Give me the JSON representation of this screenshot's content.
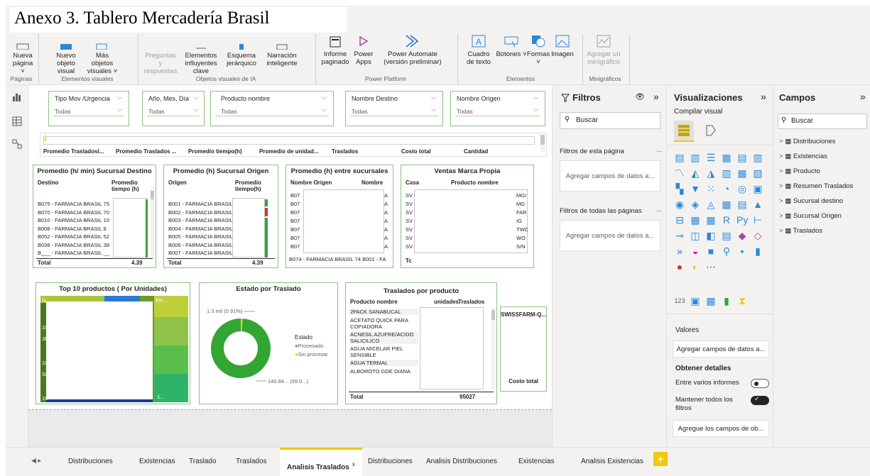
{
  "doc_title": "Anexo 3. Tablero Mercadería Brasil",
  "ribbon": {
    "buttons": [
      {
        "id": "nueva-pagina",
        "label": "Nueva página ˅"
      },
      {
        "id": "nuevo-objeto",
        "label": "Nuevo objeto visual"
      },
      {
        "id": "mas-objetos",
        "label": "Más objetos visuales ˅"
      },
      {
        "id": "preguntas",
        "label": "Preguntas y respuestas"
      },
      {
        "id": "elementos-influyentes",
        "label": "Elementos influyentes clave"
      },
      {
        "id": "esquema",
        "label": "Esquema jerárquico"
      },
      {
        "id": "narracion",
        "label": "Narración inteligente"
      },
      {
        "id": "informe-paginado",
        "label": "Informe paginado"
      },
      {
        "id": "power-apps",
        "label": "Power Apps"
      },
      {
        "id": "power-automate",
        "label": "Power Automate (versión preliminar)"
      },
      {
        "id": "cuadro-texto",
        "label": "Cuadro de texto"
      },
      {
        "id": "botones",
        "label": "Botones ˅"
      },
      {
        "id": "formas",
        "label": "Formas ˅"
      },
      {
        "id": "imagen",
        "label": "Imagen"
      },
      {
        "id": "minigrafico",
        "label": "Agregar un minigráfico"
      }
    ],
    "groups": [
      "Páginas",
      "Elementos visuales",
      "Objetos visuales de IA",
      "Power Platform",
      "Elementos",
      "Minigráficos"
    ]
  },
  "slicers": [
    {
      "label": "Tipo Mov /Urgencia",
      "value": "Todas"
    },
    {
      "label": "Año, Mes, Día",
      "value": "Todas"
    },
    {
      "label": "Producto nombre",
      "value": "Todas"
    },
    {
      "label": "Nombre Destino",
      "value": "Todas"
    },
    {
      "label": "Nombre Origen",
      "value": "Todas"
    }
  ],
  "card_row": {
    "value": "1",
    "headers": [
      "Promedio Trasladosl...",
      "Promedio Traslados ...",
      "Promedio tiempo(h)",
      "Promedio de unidad...",
      "Traslados",
      "Costo total",
      "Cantidad"
    ]
  },
  "table_destino": {
    "title": "Promedio (h/ min) Sucursal Destino",
    "col1": "Destino",
    "col2": "Promedio tiempo (h)",
    "rows": [
      "B075 - FARMACIA BRASIL 75",
      "B070 - FARMACIA BRASIL 70",
      "B010 - FARMACIA BRASIL 10",
      "B008 - FARMACIA BRASIL 8",
      "B052 - FARMACIA BRASIL 52",
      "B038 - FARMACIA BRASIL 38",
      "B___ - FARMACIA BRASIL __"
    ],
    "total_label": "Total",
    "total_value": "4.39"
  },
  "table_origen": {
    "title": "Promedio (h) Sucursal Origen",
    "col1": "Origen",
    "col2": "Promedio tiempo(h)",
    "rows": [
      "B001 - FARMACIA BRASIL",
      "B002 - FARMACIA BRASIL",
      "B003 - FARMACIA BRASIL",
      "B004 - FARMACIA BRASIL",
      "B005 - FARMACIA BRASIL",
      "B006 - FARMACIA BRASIL",
      "B007 - FARMACIA BRASIL"
    ],
    "total_label": "Total",
    "total_value": "4.39"
  },
  "table_entre": {
    "title": "Promedio (h) entre sucursales",
    "col1": "Nombre Origen",
    "col2": "Nombre",
    "rows": [
      "B07",
      "B07",
      "B07",
      "B07",
      "B07",
      "B07",
      "B07"
    ],
    "row_suffix": "A",
    "last_row": "B074 - FARMACIA BRASIL 74  B001 - FA"
  },
  "table_ventas": {
    "title": "Ventas Marca Propia",
    "col1": "Casa",
    "col2": "Producto nombre",
    "rows_left": [
      "SV",
      "SV",
      "SV",
      "SV",
      "SV",
      "SV",
      "SV"
    ],
    "rows_right": [
      "MG/",
      "MG",
      "FAR",
      "IG",
      "TWC",
      "WO",
      "S/N"
    ],
    "total_label": "Tc"
  },
  "top10": {
    "title": "Top 10 productos ( Por Unidades)",
    "labels": [
      "N",
      "10",
      "JE",
      "10",
      "SL",
      "10",
      "ER...",
      "1..."
    ]
  },
  "donut": {
    "title": "Estado por Traslado",
    "label_small": "1.3 mil (0.91%)",
    "label_large": "140.84... (99.0...)",
    "legend_title": "Estado",
    "legend": [
      {
        "name": "Procesado",
        "color": "#33a532"
      },
      {
        "name": "Sin procesar",
        "color": "#d6d613"
      }
    ],
    "values": [
      99.09,
      0.91
    ]
  },
  "traslados_prod": {
    "title": "Traslados por producto",
    "col1": "Producto nombre",
    "col2": "unidades",
    "col3": "Traslados",
    "rows": [
      "2PACK SANABUCAL",
      "ACETATO QUICK PARA COPIADORA",
      "ACNESIL AZUFRE/ACIDO SALICILICO",
      "AGUA MICELAR PIEL SENSIBLE",
      "AGUA TERMAL",
      "ALBOROTO GDE DIANA"
    ],
    "total_label": "Total",
    "total_value": "95027"
  },
  "swissfarm": {
    "title": "SWISSFARM-Q...",
    "footer": "Costo total"
  },
  "filters": {
    "title": "Filtros",
    "search": "Buscar",
    "this_page": "Filtros de esta página",
    "drop1": "Agregar campos de datos a...",
    "all_pages": "Filtros de todas las páginas",
    "drop2": "Agregar campos de datos a...",
    "more": "..."
  },
  "visualizations": {
    "title": "Visualizaciones",
    "compile": "Compilar visual",
    "values": "Valores",
    "values_drop": "Agregar campos de datos a...",
    "details": "Obtener detalles",
    "cross": "Entre varios informes",
    "keep": "Mantener todos los filtros",
    "keep_drop": "Agregue los campos de ob..."
  },
  "fields": {
    "title": "Campos",
    "search": "Buscar",
    "tables": [
      "Distribuciones",
      "Existencias",
      "Producto",
      "Resumen Traslados",
      "Sucursal destino",
      "Sucursal Origen",
      "Traslados"
    ]
  },
  "tabs": [
    "Distribuciones",
    "Existencias",
    "Traslado",
    "Traslados",
    "Analisis Traslados",
    "Distribuciones",
    "Analisis Distribuciones",
    "Existencias",
    "Analisis Existencias"
  ],
  "active_tab": "Analisis Traslados",
  "tab_close": "x",
  "tab_add": "+",
  "colors": {
    "accent": "#f2c811",
    "visual_border": "#8cc084",
    "donut_green": "#33a532",
    "donut_yellow": "#d6d613"
  }
}
